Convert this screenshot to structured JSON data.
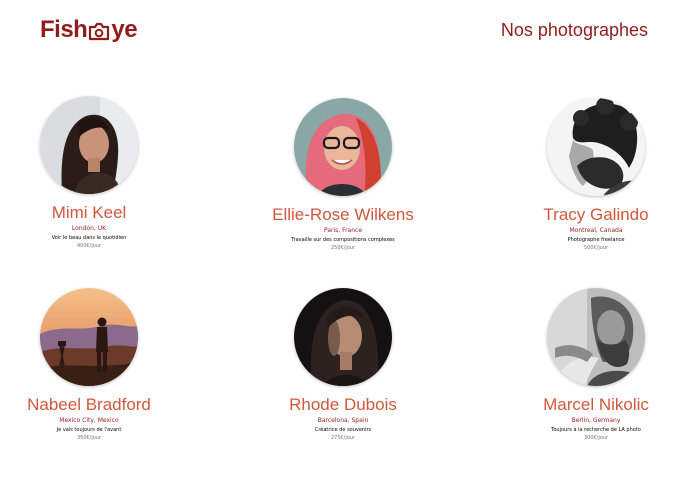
{
  "header": {
    "logo_text_start": "Fish",
    "logo_text_end": "ye",
    "logo_icon": "camera-icon",
    "page_title": "Nos photographes"
  },
  "colors": {
    "brand": "#901c1c",
    "name": "#d3573c",
    "price": "#757575"
  },
  "photographers": [
    {
      "name": "Mimi Keel",
      "location": "London, UK",
      "tagline": "Voir le beau dans le quotidien",
      "price": "400€/jour"
    },
    {
      "name": "Ellie-Rose Wilkens",
      "location": "Paris, France",
      "tagline": "Travaille sur des compositions complexes",
      "price": "250€/jour"
    },
    {
      "name": "Tracy Galindo",
      "location": "Montreal, Canada",
      "tagline": "Photographe freelance",
      "price": "500€/jour"
    },
    {
      "name": "Nabeel Bradford",
      "location": "Mexico City, Mexico",
      "tagline": "Je vais toujours de l'avant",
      "price": "350€/jour"
    },
    {
      "name": "Rhode Dubois",
      "location": "Barcelona, Spain",
      "tagline": "Créatrice de souvenirs",
      "price": "275€/jour"
    },
    {
      "name": "Marcel Nikolic",
      "location": "Berlin, Germany",
      "tagline": "Toujours à la recherche de LA photo",
      "price": "300€/jour"
    }
  ]
}
